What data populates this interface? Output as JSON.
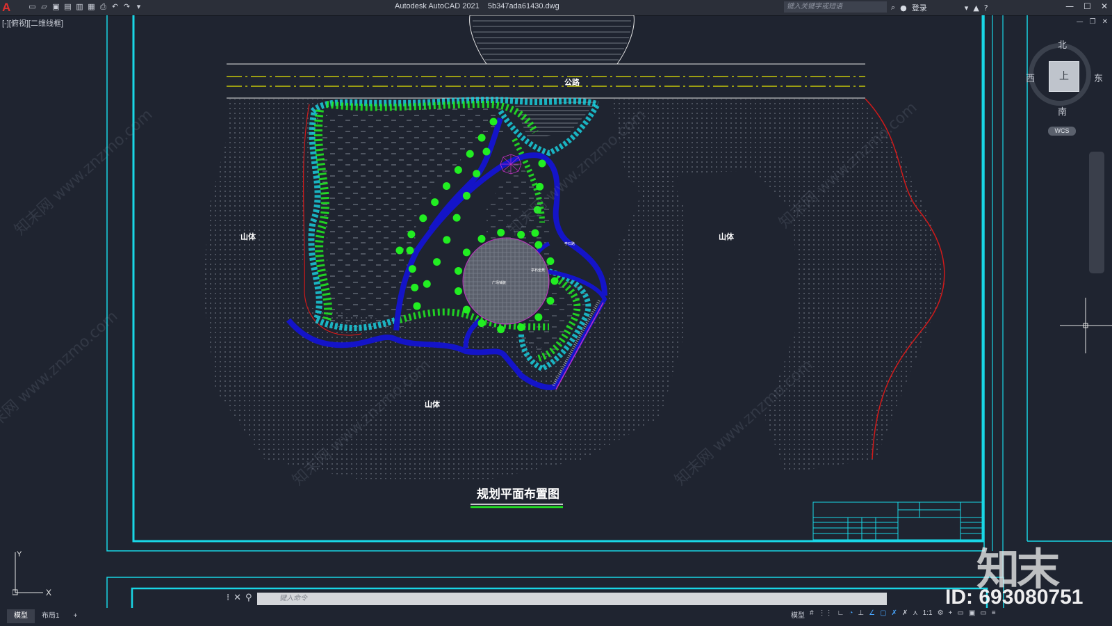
{
  "titlebar": {
    "app_letter": "A",
    "title": "Autodesk AutoCAD 2021    5b347ada61430.dwg",
    "search_placeholder": "键入关键字或短语",
    "login_label": "登录",
    "help_icon": "?"
  },
  "viewport_label": "[-][俯视][二维线框]",
  "drawing": {
    "road_label": "公路",
    "mountain_labels": [
      "山体",
      "山体",
      "山体"
    ],
    "plan_title": "规划平面布置图",
    "small_label_1": "亭石路",
    "small_label_2": "亭石坐凳",
    "small_label_3": "广场铺装"
  },
  "viewcube": {
    "north": "北",
    "south": "南",
    "east": "东",
    "west": "西",
    "face": "上",
    "wcs": "WCS"
  },
  "command": {
    "placeholder": "键入命令"
  },
  "layout_tabs": [
    "模型",
    "布局1",
    "+"
  ],
  "status": {
    "model_label": "模型",
    "scale": "1:1"
  },
  "watermark": {
    "logo": "知末",
    "id": "ID: 693080751",
    "diag_text": "知末网 www.znzmo.com"
  },
  "ucs": {
    "x_label": "X",
    "y_label": "Y"
  },
  "colors": {
    "background": "#1f2430",
    "frame_cyan": "#19d7e6",
    "path_blue": "#1414c8",
    "tree_green": "#22ee22",
    "road_yellow": "#e6e600",
    "boundary_red": "#d11a1a"
  }
}
